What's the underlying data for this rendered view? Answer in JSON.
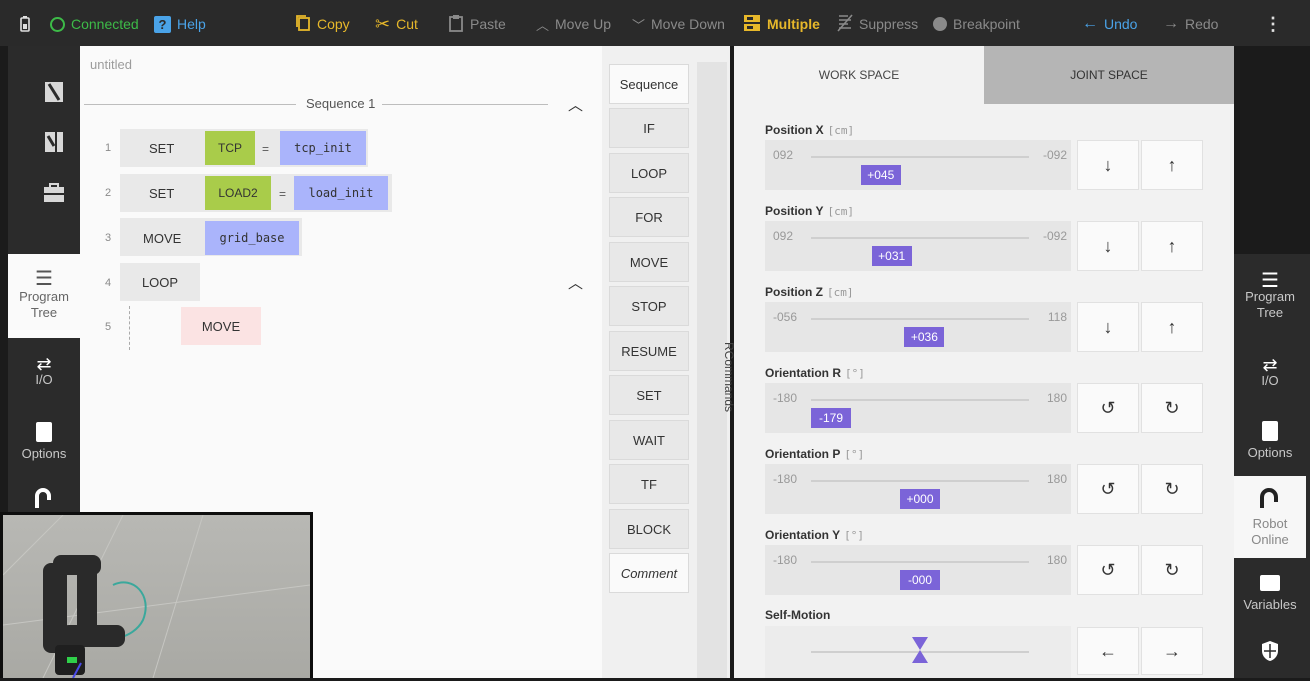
{
  "toolbar": {
    "connection_label": "Connected",
    "help_label": "Help",
    "copy_label": "Copy",
    "cut_label": "Cut",
    "paste_label": "Paste",
    "move_up_label": "Move Up",
    "move_down_label": "Move Down",
    "multiple_label": "Multiple",
    "suppress_label": "Suppress",
    "breakpoint_label": "Breakpoint",
    "undo_label": "Undo",
    "redo_label": "Redo"
  },
  "left_rail": {
    "program_tree_label": "Program Tree",
    "io_label": "I/O",
    "options_label": "Options"
  },
  "program": {
    "file_name": "untitled",
    "sequence_label": "Sequence 1",
    "rows": [
      {
        "num": "1",
        "cmd": "SET",
        "arg1": "TCP",
        "eq": "=",
        "arg2": "tcp_init"
      },
      {
        "num": "2",
        "cmd": "SET",
        "arg1": "LOAD2",
        "eq": "=",
        "arg2": "load_init"
      },
      {
        "num": "3",
        "cmd": "MOVE",
        "arg2": "grid_base"
      },
      {
        "num": "4",
        "cmd": "LOOP"
      },
      {
        "num": "5",
        "cmd": "MOVE"
      }
    ]
  },
  "palette": {
    "items": [
      "Sequence",
      "IF",
      "LOOP",
      "FOR",
      "MOVE",
      "STOP",
      "RESUME",
      "SET",
      "WAIT",
      "TF",
      "BLOCK",
      "Comment"
    ],
    "side_label": "RCommands"
  },
  "workspace": {
    "tab_work": "WORK SPACE",
    "tab_joint": "JOINT SPACE",
    "axes": [
      {
        "title": "Position X",
        "unit": "[cm]",
        "min": "092",
        "max": "-092",
        "value": "+045",
        "level": 0.32
      },
      {
        "title": "Position Y",
        "unit": "[cm]",
        "min": "092",
        "max": "-092",
        "value": "+031",
        "level": 0.37
      },
      {
        "title": "Position Z",
        "unit": "[cm]",
        "min": "-056",
        "max": "118",
        "value": "+036",
        "level": 0.52
      },
      {
        "title": "Orientation R",
        "unit": "[°]",
        "min": "-180",
        "max": "180",
        "value": "-179",
        "level": 0.0
      },
      {
        "title": "Orientation P",
        "unit": "[°]",
        "min": "-180",
        "max": "180",
        "value": "+000",
        "level": 0.5
      },
      {
        "title": "Orientation Y",
        "unit": "[°]",
        "min": "-180",
        "max": "180",
        "value": "-000",
        "level": 0.5
      }
    ],
    "self_motion_label": "Self-Motion",
    "self_motion_level": 0.5
  },
  "right_rail": {
    "program_tree_label": "Program Tree",
    "io_label": "I/O",
    "options_label": "Options",
    "robot_label": "Robot Online",
    "variables_label": "Variables"
  },
  "colors": {
    "accent_purple": "#7b64d8",
    "tag_green": "#a9cc4a",
    "tag_blue": "#aab4fb",
    "toolbar_yellow": "#e7b82a"
  }
}
